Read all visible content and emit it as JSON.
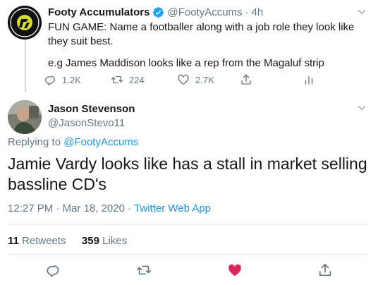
{
  "parent_tweet": {
    "display_name": "Footy Accumulators",
    "handle": "@FootyAccums",
    "separator": "·",
    "time": "4h",
    "avatar_label": "FOOTY ACCUMULATORS",
    "text": "FUN GAME: Name a footballer along with a job role they look like they suit best.",
    "text_2": "e.g James Maddison looks like a rep from the Magaluf strip",
    "actions": {
      "replies": "1.2K",
      "retweets": "224",
      "likes": "2.7K"
    }
  },
  "main_tweet": {
    "display_name": "Jason Stevenson",
    "handle": "@JasonStevo11",
    "replying_prefix": "Replying to",
    "replying_to": "@FootyAccums",
    "text": "Jamie Vardy looks like has a stall in market selling bassline CD's",
    "time": "12:27 PM",
    "separator": "·",
    "date": "Mar 18, 2020",
    "source": "Twitter Web App",
    "retweet_count": "11",
    "retweet_label": "Retweets",
    "like_count": "359",
    "like_label": "Likes"
  },
  "colors": {
    "accent": "#1b95e0",
    "muted": "#657786",
    "text": "#14171a",
    "like": "#e0245e",
    "avatar_badge": "#d6dc2c"
  },
  "icons": [
    "chevron-down-icon",
    "verified-icon",
    "reply-icon",
    "retweet-icon",
    "like-icon",
    "share-icon",
    "analytics-icon"
  ]
}
